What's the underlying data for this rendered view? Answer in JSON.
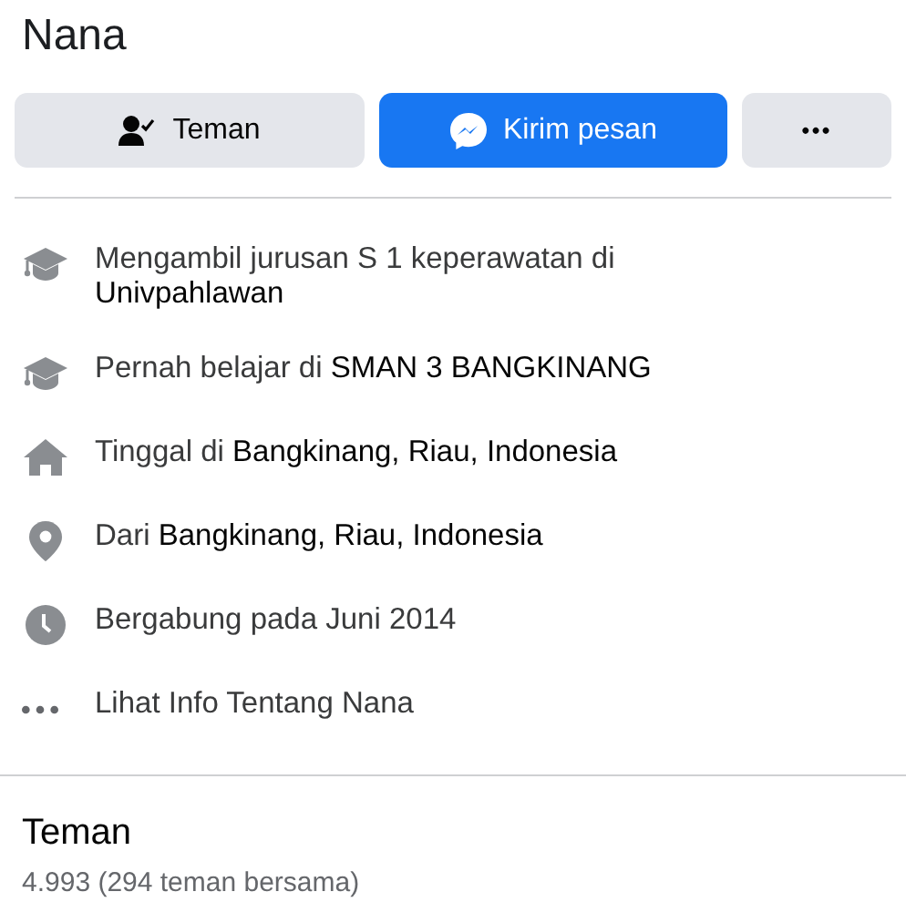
{
  "profile": {
    "name": "Nana"
  },
  "actions": [
    {
      "kind": "friend",
      "label": "Teman"
    },
    {
      "kind": "message",
      "label": "Kirim pesan"
    },
    {
      "kind": "more",
      "label": "•••"
    }
  ],
  "intro": [
    {
      "kind": "school",
      "text": "Mengambil jurusan S 1 keperawatan di **Univpahlawan**"
    },
    {
      "kind": "school",
      "text": "Pernah belajar di **SMAN 3 BANGKINANG**"
    },
    {
      "kind": "home",
      "text": "Tinggal di **Bangkinang, Riau, Indonesia**"
    },
    {
      "kind": "pin",
      "text": "Dari **Bangkinang, Riau, Indonesia**"
    },
    {
      "kind": "clock",
      "text": "Bergabung pada Juni 2014"
    },
    {
      "kind": "more",
      "text": "Lihat Info Tentang Nana"
    }
  ],
  "friends": {
    "title": "Teman",
    "count": "4.993 (294 teman bersama)"
  }
}
